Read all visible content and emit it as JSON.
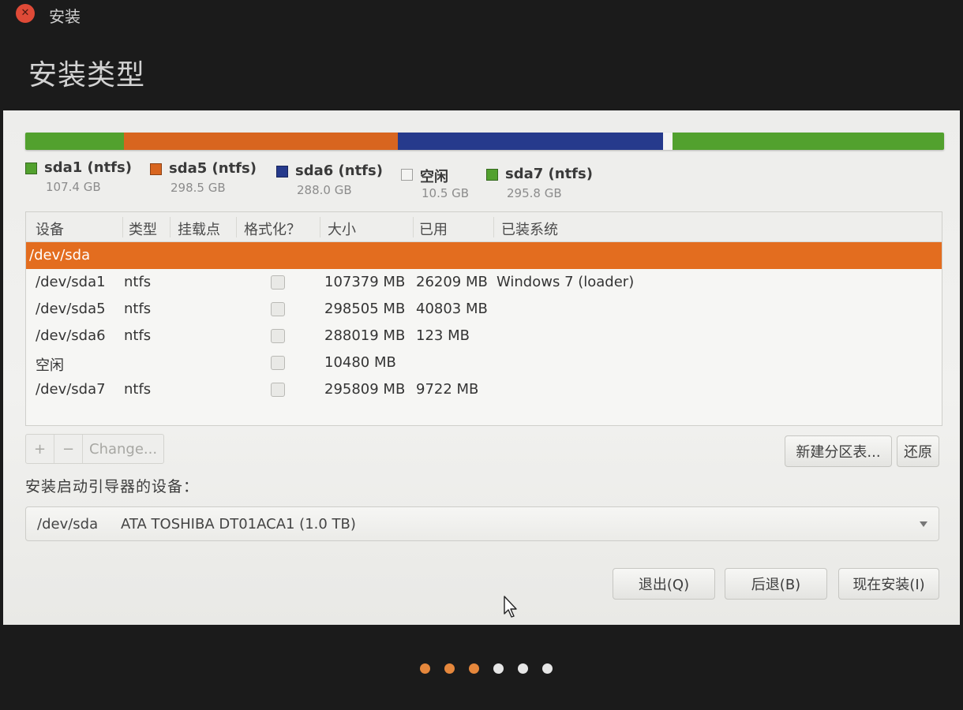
{
  "window": {
    "title": "安装",
    "page_title": "安装类型",
    "close_icon": "close-icon"
  },
  "colors": {
    "ntfs_green": "#52a12e",
    "sda5_orange": "#d8651f",
    "sda6_blue": "#263a8c",
    "free_white": "#f4f4f2",
    "selection": "#e36d1f",
    "dot_done": "#e5873c",
    "dot_todo": "#e6e6e6"
  },
  "partition_bar": [
    {
      "name": "sda1",
      "fraction": 0.1074,
      "color": "#52a12e"
    },
    {
      "name": "sda5",
      "fraction": 0.2985,
      "color": "#d8651f"
    },
    {
      "name": "sda6",
      "fraction": 0.288,
      "color": "#263a8c"
    },
    {
      "name": "free",
      "fraction": 0.0105,
      "color": "#f4f4f2"
    },
    {
      "name": "sda7",
      "fraction": 0.2958,
      "color": "#52a12e"
    }
  ],
  "legend": [
    {
      "name": "sda1 (ntfs)",
      "size": "107.4 GB",
      "color": "#52a12e"
    },
    {
      "name": "sda5 (ntfs)",
      "size": "298.5 GB",
      "color": "#d8651f"
    },
    {
      "name": "sda6 (ntfs)",
      "size": "288.0 GB",
      "color": "#263a8c"
    },
    {
      "name": "空闲",
      "size": "10.5 GB",
      "color": "#f4f4f2"
    },
    {
      "name": "sda7 (ntfs)",
      "size": "295.8 GB",
      "color": "#52a12e"
    }
  ],
  "table": {
    "headers": [
      "设备",
      "类型",
      "挂载点",
      "格式化？",
      "大小",
      "已用",
      "已装系统"
    ],
    "rows": [
      {
        "device": "/dev/sda",
        "type": "",
        "mount": "",
        "format": false,
        "size": "",
        "used": "",
        "system": "",
        "selected": true,
        "has_checkbox": false
      },
      {
        "device": "/dev/sda1",
        "type": "ntfs",
        "mount": "",
        "format": false,
        "size": "107379 MB",
        "used": "26209 MB",
        "system": "Windows 7 (loader)",
        "selected": false,
        "has_checkbox": true
      },
      {
        "device": "/dev/sda5",
        "type": "ntfs",
        "mount": "",
        "format": false,
        "size": "298505 MB",
        "used": "40803 MB",
        "system": "",
        "selected": false,
        "has_checkbox": true
      },
      {
        "device": "/dev/sda6",
        "type": "ntfs",
        "mount": "",
        "format": false,
        "size": "288019 MB",
        "used": "123 MB",
        "system": "",
        "selected": false,
        "has_checkbox": true
      },
      {
        "device": "空闲",
        "type": "",
        "mount": "",
        "format": false,
        "size": "10480 MB",
        "used": "",
        "system": "",
        "selected": false,
        "has_checkbox": true
      },
      {
        "device": "/dev/sda7",
        "type": "ntfs",
        "mount": "",
        "format": false,
        "size": "295809 MB",
        "used": "9722 MB",
        "system": "",
        "selected": false,
        "has_checkbox": true
      }
    ]
  },
  "toolbar": {
    "add_label": "+",
    "remove_label": "−",
    "change_label": "Change...",
    "new_table_label": "新建分区表...",
    "revert_label": "还原"
  },
  "boot": {
    "label": "安装启动引导器的设备：",
    "device": "/dev/sda",
    "description": "ATA TOSHIBA DT01ACA1 (1.0 TB)"
  },
  "actions": {
    "quit_label": "退出(Q)",
    "back_label": "后退(B)",
    "install_label": "现在安装(I)"
  },
  "progress": {
    "total_steps": 6,
    "completed_steps": 3
  }
}
